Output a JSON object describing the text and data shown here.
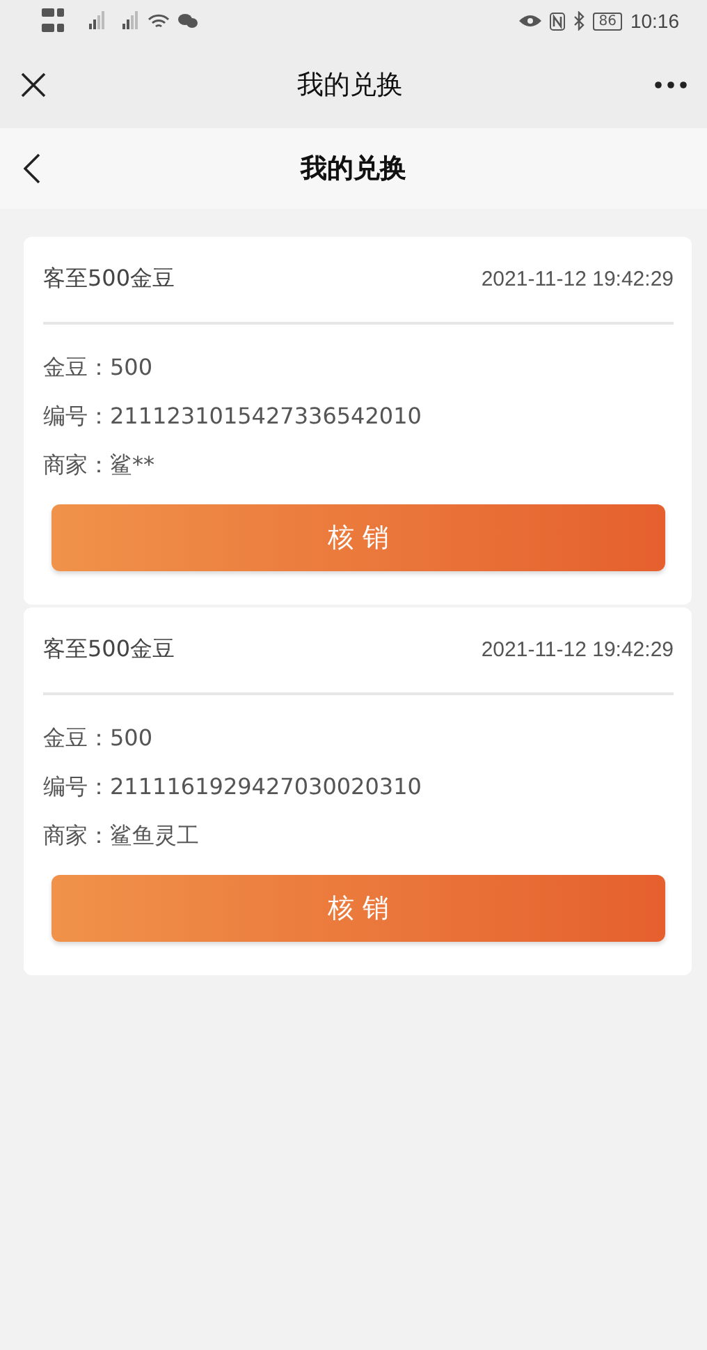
{
  "status_bar": {
    "battery": "86",
    "time": "10:16"
  },
  "window": {
    "title": "我的兑换"
  },
  "nav": {
    "title": "我的兑换"
  },
  "records": [
    {
      "title": "客至500金豆",
      "time": "2021-11-12 19:42:29",
      "fields": [
        {
          "label": "金豆：",
          "value": "500"
        },
        {
          "label": "编号：",
          "value": "2111231015427336542010"
        },
        {
          "label": "商家：",
          "value": "鲨**"
        }
      ],
      "button": "核 销"
    },
    {
      "title": "客至500金豆",
      "time": "2021-11-12 19:42:29",
      "fields": [
        {
          "label": "金豆：",
          "value": "500"
        },
        {
          "label": "编号：",
          "value": "2111161929427030020310"
        },
        {
          "label": "商家：",
          "value": "鲨鱼灵工"
        }
      ],
      "button": "核 销"
    }
  ]
}
